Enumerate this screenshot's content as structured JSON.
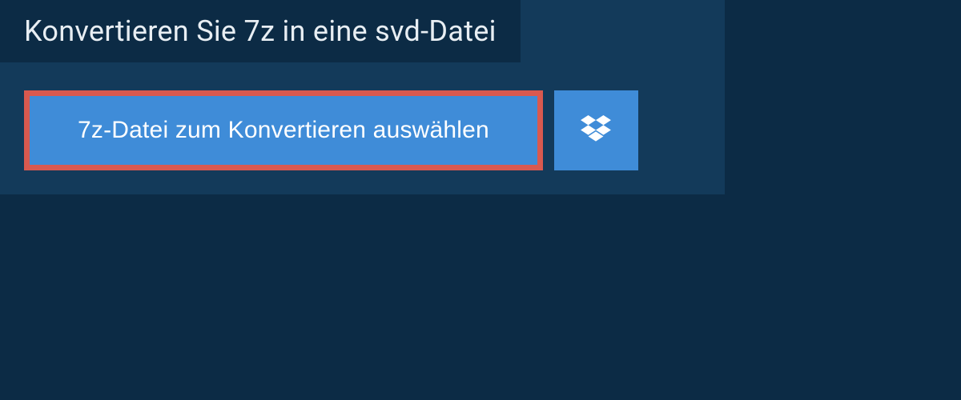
{
  "header": {
    "title": "Konvertieren Sie 7z in eine svd-Datei"
  },
  "actions": {
    "select_file_label": "7z-Datei zum Konvertieren auswählen",
    "dropbox_icon_name": "dropbox-icon"
  },
  "colors": {
    "background": "#0c2b45",
    "panel": "#133a5a",
    "button_primary": "#3f8cd8",
    "highlight_border": "#d9594f",
    "text_light": "#e8eef3"
  }
}
